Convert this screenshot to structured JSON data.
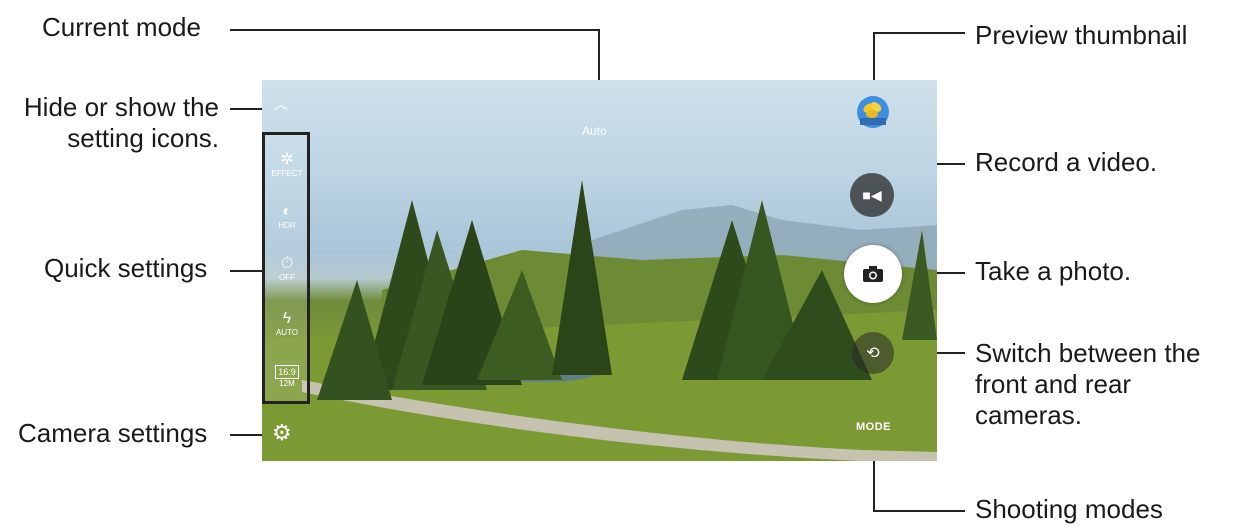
{
  "callouts": {
    "current_mode": "Current mode",
    "hide_show": "Hide or show the\nsetting icons.",
    "quick_settings": "Quick settings",
    "camera_settings": "Camera settings",
    "preview_thumbnail": "Preview thumbnail",
    "record_video": "Record a video.",
    "take_photo": "Take a photo.",
    "switch_cameras": "Switch between the\nfront and rear\ncameras.",
    "shooting_modes": "Shooting modes"
  },
  "viewfinder": {
    "mode": "Auto",
    "mode_button": "MODE",
    "quick_settings": [
      {
        "icon": "wand-icon",
        "glyph": "✲",
        "label": "EFFECT"
      },
      {
        "icon": "hdr-icon",
        "glyph": "◐",
        "label": "HDR"
      },
      {
        "icon": "timer-icon",
        "glyph": "⏱",
        "label": "OFF"
      },
      {
        "icon": "flash-icon",
        "glyph": "ϟ",
        "label": "AUTO"
      },
      {
        "icon": "ratio-icon",
        "glyph": "16:9",
        "label": "12M"
      }
    ]
  },
  "colors": {
    "sky": "#bcd4e3",
    "grass": "#7d9a36",
    "trees": "#2f4a1c",
    "button_dark": "#3a3a3a",
    "shutter": "#ffffff"
  }
}
